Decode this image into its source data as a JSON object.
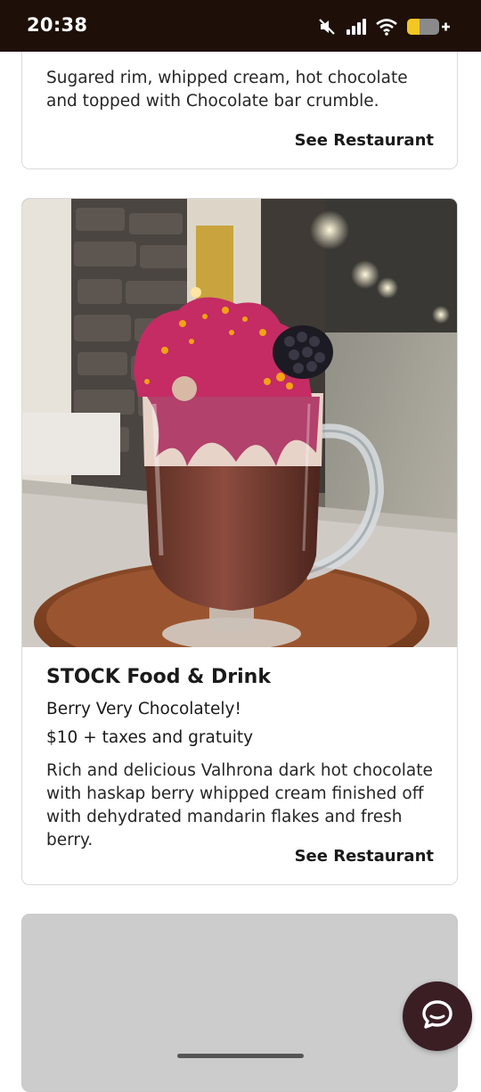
{
  "status_bar": {
    "time": "20:38",
    "icons": [
      "mute-icon",
      "cellular-signal-icon",
      "wifi-icon",
      "battery-charging-icon"
    ]
  },
  "cards": [
    {
      "description": "Sugared rim, whipped cream, hot chocolate and topped with Chocolate bar crumble.",
      "link_label": "See Restaurant"
    },
    {
      "photo_icon": "hot-chocolate-photo",
      "restaurant": "STOCK Food & Drink",
      "drink": "Berry Very Chocolately!",
      "price": "$10 + taxes and gratuity",
      "description": "Rich and delicious Valhrona dark hot chocolate with haskap berry whipped cream finished off with dehydrated mandarin flakes and fresh berry.",
      "link_label": "See Restaurant"
    }
  ],
  "chat": {
    "icon": "chat-bubble-icon"
  },
  "colors": {
    "status_bar_bg": "#1e1008",
    "chat_button_bg": "#3a1e24",
    "placeholder_bg": "#cccccc",
    "card_border": "#d9d9d9"
  }
}
